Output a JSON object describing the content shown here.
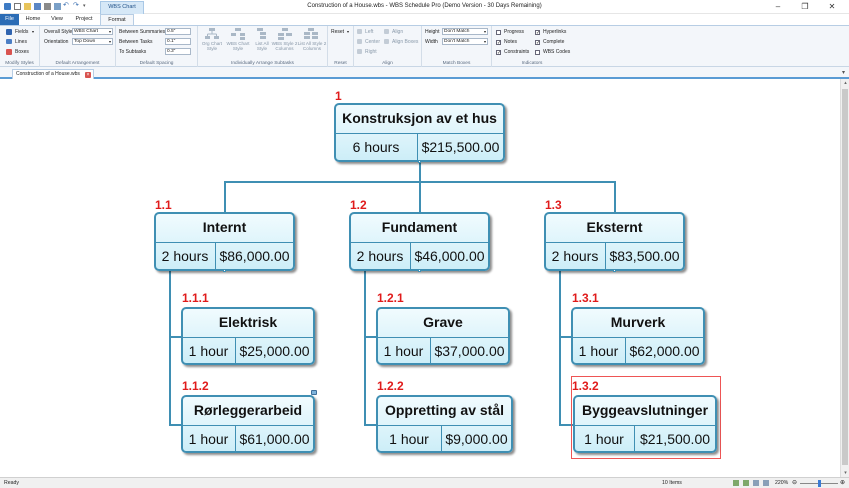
{
  "window": {
    "title": "Construction of a House.wbs - WBS Schedule Pro (Demo Version - 30 Days Remaining)"
  },
  "context_tab": "WBS Chart",
  "tabs": [
    "File",
    "Home",
    "View",
    "Project",
    "Format"
  ],
  "ribbon": {
    "modify_styles": {
      "fields": "Fields",
      "lines": "Lines",
      "boxes": "Boxes",
      "label": "Modify Styles"
    },
    "default_arrangement": {
      "overall_style_label": "Overall Style",
      "overall_style_value": "WBS Chart",
      "orientation_label": "Orientation",
      "orientation_value": "Top Down",
      "label": "Default Arrangement"
    },
    "default_spacing": {
      "between_summaries_label": "Between Summaries",
      "between_summaries_value": "0.5\"",
      "between_tasks_label": "Between Tasks",
      "between_tasks_value": "0.1\"",
      "to_subtasks_label": "To Subtasks",
      "to_subtasks_value": "0.3\"",
      "label": "Default Spacing"
    },
    "arrange_subtasks": {
      "buttons": [
        "Org Chart Style",
        "WBS Chart Style",
        "List All Style",
        "WBS Style 2 Columns",
        "List All Style 2 Columns"
      ],
      "label": "Individually Arrange Subtasks"
    },
    "reset": {
      "button": "Reset",
      "label": "Reset"
    },
    "align": {
      "left": "Left",
      "center": "Center",
      "right": "Right",
      "align": "Align",
      "align_boxes": "Align Boxes",
      "label": "Align"
    },
    "match_boxes": {
      "height_label": "Height",
      "height_value": "Don't Match",
      "width_label": "Width",
      "width_value": "Don't Match",
      "label": "Match Boxes"
    },
    "indicators": {
      "progress": "Progress",
      "notes": "Notes",
      "constraints": "Constraints",
      "hyperlinks": "Hyperlinks",
      "complete": "Complete",
      "wbs_codes": "WBS Codes",
      "progress_checked": false,
      "notes_checked": true,
      "constraints_checked": true,
      "hyperlinks_checked": true,
      "complete_checked": true,
      "wbs_codes_checked": false,
      "label": "Indicators"
    }
  },
  "document_tab": "Construction of a House.wbs",
  "wbs": {
    "root": {
      "num": "1",
      "name": "Konstruksjon av et hus",
      "hours": "6 hours",
      "cost": "$215,500.00"
    },
    "summaries": [
      {
        "num": "1.1",
        "name": "Internt",
        "hours": "2 hours",
        "cost": "$86,000.00"
      },
      {
        "num": "1.2",
        "name": "Fundament",
        "hours": "2 hours",
        "cost": "$46,000.00"
      },
      {
        "num": "1.3",
        "name": "Eksternt",
        "hours": "2 hours",
        "cost": "$83,500.00"
      }
    ],
    "tasks": [
      {
        "num": "1.1.1",
        "name": "Elektrisk",
        "hours": "1 hour",
        "cost": "$25,000.00"
      },
      {
        "num": "1.1.2",
        "name": "Rørleggerarbeid",
        "hours": "1 hour",
        "cost": "$61,000.00"
      },
      {
        "num": "1.2.1",
        "name": "Grave",
        "hours": "1 hour",
        "cost": "$37,000.00"
      },
      {
        "num": "1.2.2",
        "name": "Oppretting av stål",
        "hours": "1 hour",
        "cost": "$9,000.00"
      },
      {
        "num": "1.3.1",
        "name": "Murverk",
        "hours": "1 hour",
        "cost": "$62,000.00"
      },
      {
        "num": "1.3.2",
        "name": "Byggeavslutninger",
        "hours": "1 hour",
        "cost": "$21,500.00"
      }
    ]
  },
  "status": {
    "ready": "Ready",
    "items": "10 Items",
    "zoom": "220%"
  }
}
